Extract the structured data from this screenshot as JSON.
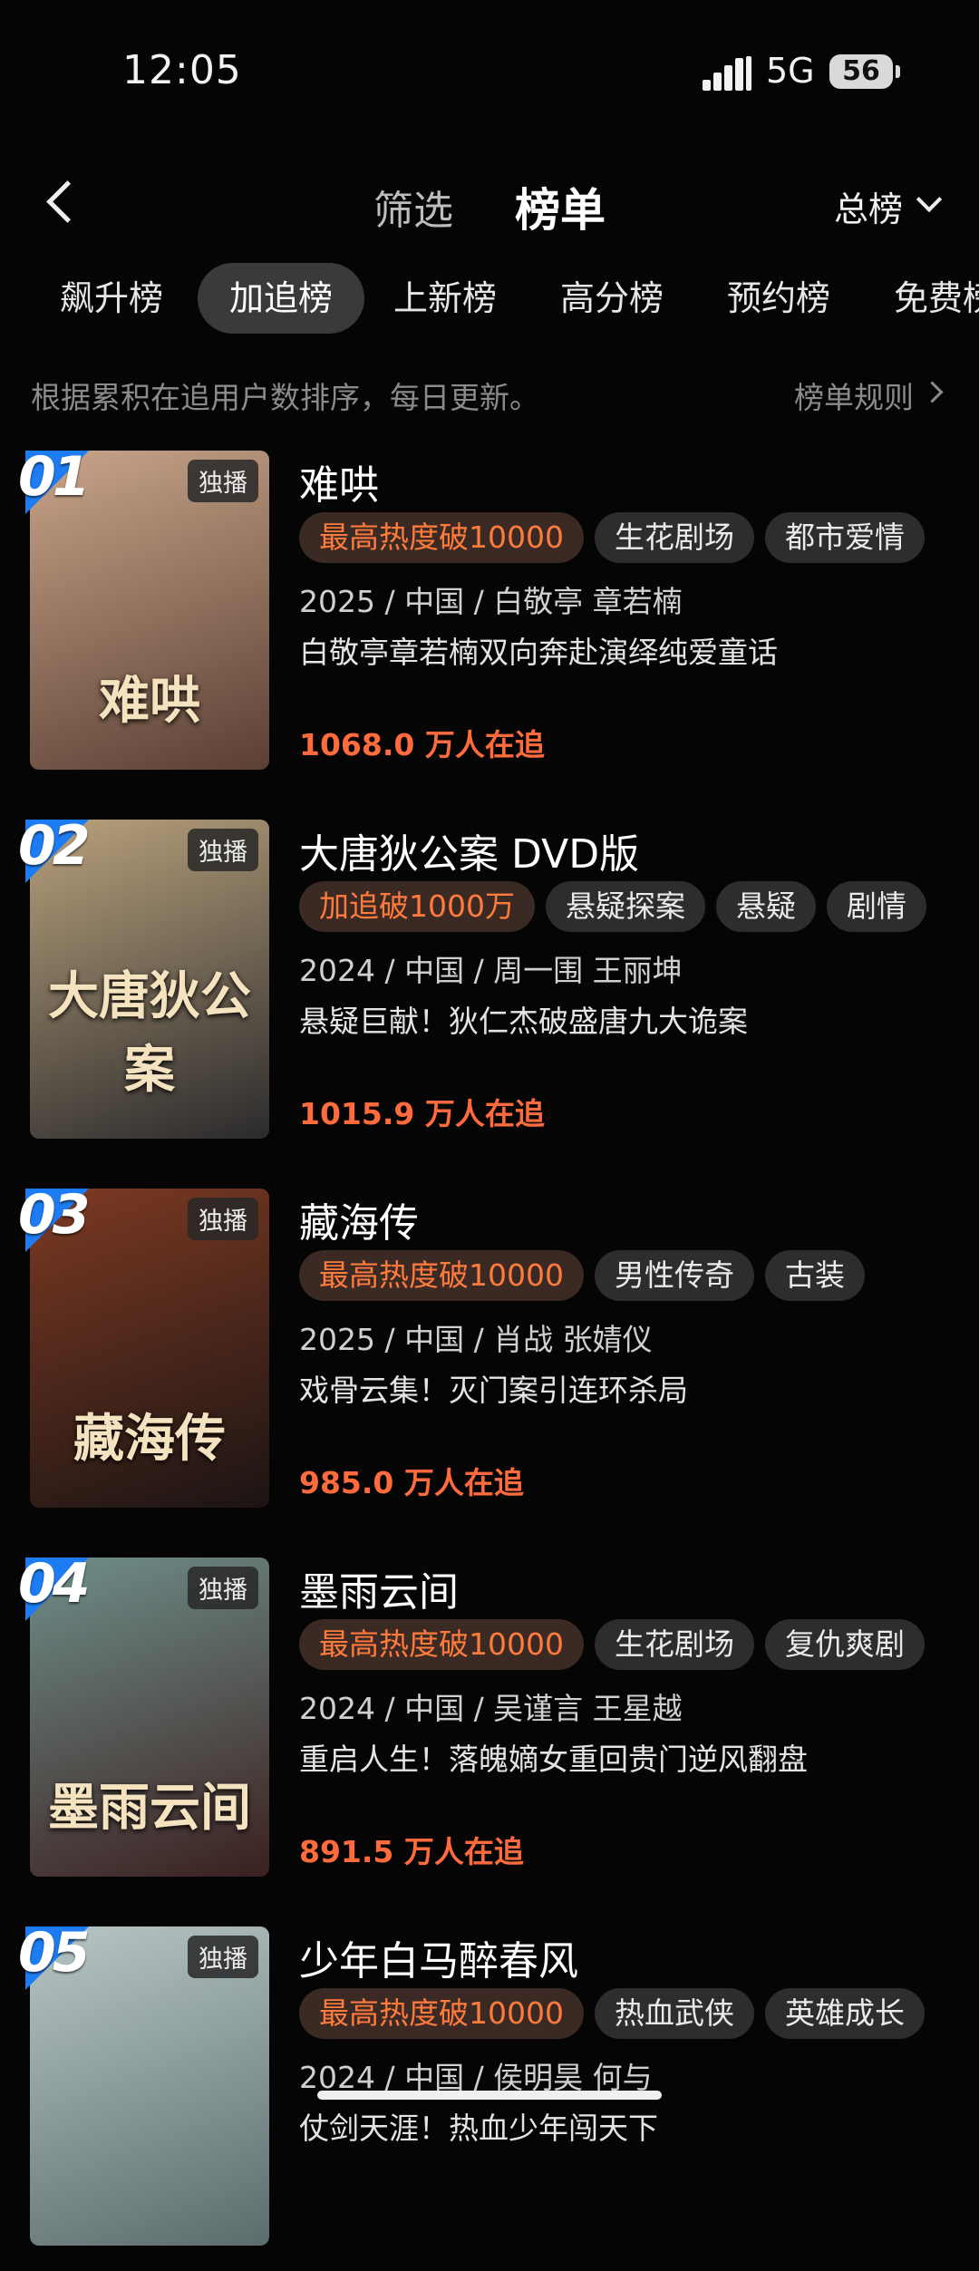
{
  "status": {
    "time": "12:05",
    "network": "5G",
    "battery": "56"
  },
  "nav": {
    "filter_tab": "筛选",
    "rank_tab": "榜单",
    "total_dropdown": "总榜"
  },
  "categories": [
    "飙升榜",
    "加追榜",
    "上新榜",
    "高分榜",
    "预约榜",
    "免费榜"
  ],
  "active_category": "加追榜",
  "description": "根据累积在追用户数排序，每日更新。",
  "rules_link": "榜单规则",
  "items": [
    {
      "rank": "01",
      "badge": "独播",
      "poster_text": "难哄",
      "title": "难哄",
      "tags": [
        "最高热度破10000",
        "生花剧场",
        "都市爱情"
      ],
      "meta": "2025 / 中国 / 白敬亭 章若楠",
      "intro": "白敬亭章若楠双向奔赴演绎纯爱童话",
      "followers": "1068.0 万人在追",
      "poster_colors": [
        "#c9a58a",
        "#5a3f33"
      ]
    },
    {
      "rank": "02",
      "badge": "独播",
      "poster_text": "大唐狄公案",
      "title": "大唐狄公案 DVD版",
      "tags": [
        "加追破1000万",
        "悬疑探案",
        "悬疑",
        "剧情"
      ],
      "meta": "2024 / 中国 / 周一围 王丽坤",
      "intro": "悬疑巨献！狄仁杰破盛唐九大诡案",
      "followers": "1015.9 万人在追",
      "poster_colors": [
        "#b9a27c",
        "#2b2a2c"
      ]
    },
    {
      "rank": "03",
      "badge": "独播",
      "poster_text": "藏海传",
      "title": "藏海传",
      "tags": [
        "最高热度破10000",
        "男性传奇",
        "古装"
      ],
      "meta": "2025 / 中国 / 肖战 张婧仪",
      "intro": "戏骨云集！灭门案引连环杀局",
      "followers": "985.0 万人在追",
      "poster_colors": [
        "#7d3a22",
        "#1b1414"
      ]
    },
    {
      "rank": "04",
      "badge": "独播",
      "poster_text": "墨雨云间",
      "title": "墨雨云间",
      "tags": [
        "最高热度破10000",
        "生花剧场",
        "复仇爽剧"
      ],
      "meta": "2024 / 中国 / 吴谨言 王星越",
      "intro": "重启人生！落魄嫡女重回贵门逆风翻盘",
      "followers": "891.5 万人在追",
      "poster_colors": [
        "#6f8f8a",
        "#3b2020"
      ]
    },
    {
      "rank": "05",
      "badge": "独播",
      "poster_text": "",
      "title": "少年白马醉春风",
      "tags": [
        "最高热度破10000",
        "热血武侠",
        "英雄成长"
      ],
      "meta": "2024 / 中国 / 侯明昊 何与",
      "intro": "仗剑天涯！热血少年闯天下",
      "followers": "",
      "poster_colors": [
        "#b8c7c6",
        "#5b6c6c"
      ]
    }
  ]
}
